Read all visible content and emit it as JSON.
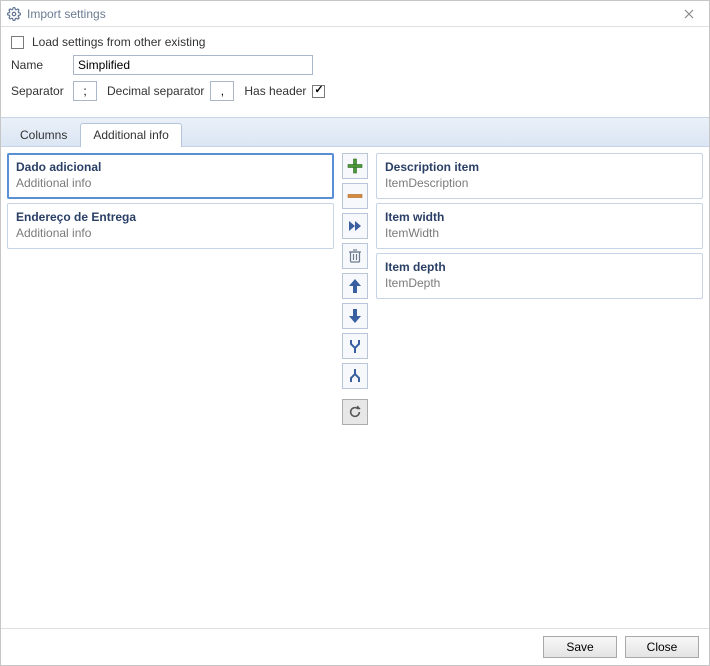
{
  "window": {
    "title": "Import settings"
  },
  "form": {
    "load_from_existing_label": "Load settings from other existing",
    "load_from_existing_checked": false,
    "name_label": "Name",
    "name_value": "Simplified",
    "separator_label": "Separator",
    "separator_value": ";",
    "decimal_separator_label": "Decimal separator",
    "decimal_separator_value": ",",
    "has_header_label": "Has header",
    "has_header_checked": true
  },
  "tabs": [
    {
      "label": "Columns",
      "active": false
    },
    {
      "label": "Additional info",
      "active": true
    }
  ],
  "left_list": [
    {
      "title": "Dado adicional",
      "sub": "Additional info",
      "selected": true
    },
    {
      "title": "Endereço de Entrega",
      "sub": "Additional info",
      "selected": false
    }
  ],
  "right_list": [
    {
      "title": "Description item",
      "sub": "ItemDescription"
    },
    {
      "title": "Item width",
      "sub": "ItemWidth"
    },
    {
      "title": "Item depth",
      "sub": "ItemDepth"
    }
  ],
  "toolbar": {
    "add": "add-icon",
    "remove": "remove-icon",
    "move_all_right": "double-right-icon",
    "delete": "trash-icon",
    "move_up": "arrow-up-icon",
    "move_down": "arrow-down-icon",
    "merge": "merge-icon",
    "split": "split-icon",
    "refresh": "refresh-icon"
  },
  "footer": {
    "save_label": "Save",
    "close_label": "Close"
  }
}
